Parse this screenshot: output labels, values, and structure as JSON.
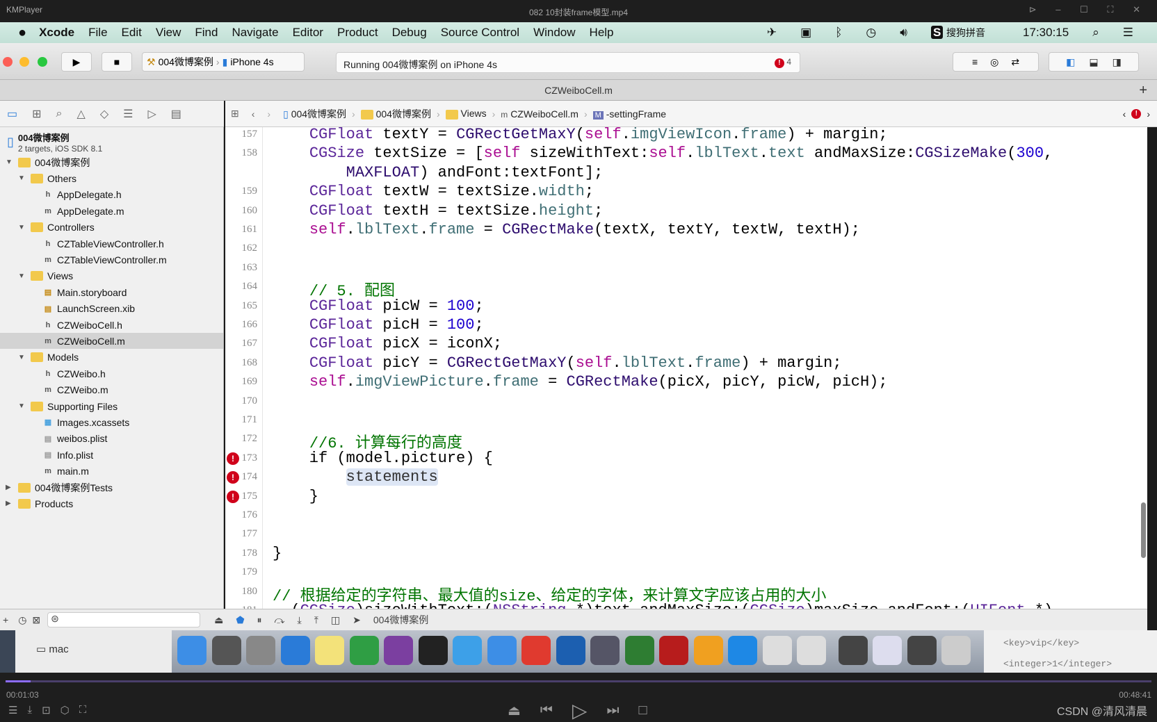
{
  "player": {
    "app": "KMPlayer",
    "title": "082 10封装frame模型.mp4",
    "elapsed": "00:01:03",
    "total": "00:48:41",
    "progress_percent": 2.2,
    "watermark": "CSDN @清风清晨"
  },
  "menubar": {
    "items": [
      "Xcode",
      "File",
      "Edit",
      "View",
      "Find",
      "Navigate",
      "Editor",
      "Product",
      "Debug",
      "Source Control",
      "Window",
      "Help"
    ],
    "input_method": "搜狗拼音",
    "clock": "17:30:15"
  },
  "toolbar": {
    "scheme": "004微博案例",
    "device": "iPhone 4s",
    "status": "Running 004微博案例 on iPhone 4s",
    "error_count": "4"
  },
  "tab": {
    "title": "CZWeiboCell.m"
  },
  "jumpbar": {
    "items": [
      "004微博案例",
      "004微博案例",
      "Views",
      "CZWeiboCell.m",
      "-settingFrame"
    ]
  },
  "project": {
    "name": "004微博案例",
    "subtitle": "2 targets, iOS SDK 8.1"
  },
  "tree": [
    {
      "label": "004微博案例",
      "level": 0,
      "kind": "folder",
      "open": true
    },
    {
      "label": "Others",
      "level": 1,
      "kind": "folder",
      "open": true
    },
    {
      "label": "AppDelegate.h",
      "level": 2,
      "kind": "h"
    },
    {
      "label": "AppDelegate.m",
      "level": 2,
      "kind": "m"
    },
    {
      "label": "Controllers",
      "level": 1,
      "kind": "folder",
      "open": true
    },
    {
      "label": "CZTableViewController.h",
      "level": 2,
      "kind": "h"
    },
    {
      "label": "CZTableViewController.m",
      "level": 2,
      "kind": "m"
    },
    {
      "label": "Views",
      "level": 1,
      "kind": "folder",
      "open": true
    },
    {
      "label": "Main.storyboard",
      "level": 2,
      "kind": "sb"
    },
    {
      "label": "LaunchScreen.xib",
      "level": 2,
      "kind": "xib"
    },
    {
      "label": "CZWeiboCell.h",
      "level": 2,
      "kind": "h"
    },
    {
      "label": "CZWeiboCell.m",
      "level": 2,
      "kind": "m",
      "selected": true
    },
    {
      "label": "Models",
      "level": 1,
      "kind": "folder",
      "open": true
    },
    {
      "label": "CZWeibo.h",
      "level": 2,
      "kind": "h"
    },
    {
      "label": "CZWeibo.m",
      "level": 2,
      "kind": "m"
    },
    {
      "label": "Supporting Files",
      "level": 1,
      "kind": "folder",
      "open": true
    },
    {
      "label": "Images.xcassets",
      "level": 2,
      "kind": "assets"
    },
    {
      "label": "weibos.plist",
      "level": 2,
      "kind": "plist"
    },
    {
      "label": "Info.plist",
      "level": 2,
      "kind": "plist"
    },
    {
      "label": "main.m",
      "level": 2,
      "kind": "m"
    },
    {
      "label": "004微博案例Tests",
      "level": 0,
      "kind": "folder",
      "open": false
    },
    {
      "label": "Products",
      "level": 0,
      "kind": "folder",
      "open": false
    }
  ],
  "code": [
    {
      "n": "157",
      "t": [
        [
          "    "
        ],
        [
          "CGFloat",
          "type"
        ],
        [
          " textY = "
        ],
        [
          "CGRectGetMaxY",
          "fn"
        ],
        [
          "("
        ],
        [
          "self",
          "self"
        ],
        [
          "."
        ],
        [
          "imgViewIcon",
          "prop"
        ],
        [
          "."
        ],
        [
          "frame",
          "prop"
        ],
        [
          ") + margin;"
        ]
      ]
    },
    {
      "n": "158",
      "t": [
        [
          "    "
        ],
        [
          "CGSize",
          "type"
        ],
        [
          " textSize = ["
        ],
        [
          "self",
          "self"
        ],
        [
          " sizeWithText:"
        ],
        [
          "self",
          "self"
        ],
        [
          "."
        ],
        [
          "lblText",
          "prop"
        ],
        [
          "."
        ],
        [
          "text",
          "prop"
        ],
        [
          " andMaxSize:"
        ],
        [
          "CGSizeMake",
          "fn"
        ],
        [
          "("
        ],
        [
          "300",
          "num"
        ],
        [
          ","
        ]
      ]
    },
    {
      "n": "",
      "t": [
        [
          "        "
        ],
        [
          "MAXFLOAT",
          "fn"
        ],
        [
          ") andFont:textFont];"
        ]
      ]
    },
    {
      "n": "159",
      "t": [
        [
          "    "
        ],
        [
          "CGFloat",
          "type"
        ],
        [
          " textW = textSize."
        ],
        [
          "width",
          "prop"
        ],
        [
          ";"
        ]
      ]
    },
    {
      "n": "160",
      "t": [
        [
          "    "
        ],
        [
          "CGFloat",
          "type"
        ],
        [
          " textH = textSize."
        ],
        [
          "height",
          "prop"
        ],
        [
          ";"
        ]
      ]
    },
    {
      "n": "161",
      "t": [
        [
          "    "
        ],
        [
          "self",
          "self"
        ],
        [
          "."
        ],
        [
          "lblText",
          "prop"
        ],
        [
          "."
        ],
        [
          "frame",
          "prop"
        ],
        [
          " = "
        ],
        [
          "CGRectMake",
          "fn"
        ],
        [
          "(textX, textY, textW, textH);"
        ]
      ]
    },
    {
      "n": "162",
      "t": []
    },
    {
      "n": "163",
      "t": []
    },
    {
      "n": "164",
      "t": [
        [
          "    "
        ],
        [
          "// 5. 配图",
          "com"
        ]
      ]
    },
    {
      "n": "165",
      "t": [
        [
          "    "
        ],
        [
          "CGFloat",
          "type"
        ],
        [
          " picW = "
        ],
        [
          "100",
          "num"
        ],
        [
          ";"
        ]
      ]
    },
    {
      "n": "166",
      "t": [
        [
          "    "
        ],
        [
          "CGFloat",
          "type"
        ],
        [
          " picH = "
        ],
        [
          "100",
          "num"
        ],
        [
          ";"
        ]
      ]
    },
    {
      "n": "167",
      "t": [
        [
          "    "
        ],
        [
          "CGFloat",
          "type"
        ],
        [
          " picX = iconX;"
        ]
      ]
    },
    {
      "n": "168",
      "t": [
        [
          "    "
        ],
        [
          "CGFloat",
          "type"
        ],
        [
          " picY = "
        ],
        [
          "CGRectGetMaxY",
          "fn"
        ],
        [
          "("
        ],
        [
          "self",
          "self"
        ],
        [
          "."
        ],
        [
          "lblText",
          "prop"
        ],
        [
          "."
        ],
        [
          "frame",
          "prop"
        ],
        [
          ") + margin;"
        ]
      ]
    },
    {
      "n": "169",
      "t": [
        [
          "    "
        ],
        [
          "self",
          "self"
        ],
        [
          "."
        ],
        [
          "imgViewPicture",
          "prop"
        ],
        [
          "."
        ],
        [
          "frame",
          "prop"
        ],
        [
          " = "
        ],
        [
          "CGRectMake",
          "fn"
        ],
        [
          "(picX, picY, picW, picH);"
        ]
      ]
    },
    {
      "n": "170",
      "t": []
    },
    {
      "n": "171",
      "t": []
    },
    {
      "n": "172",
      "t": [
        [
          "    "
        ],
        [
          "//6. 计算每行的高度",
          "com"
        ]
      ]
    },
    {
      "n": "173",
      "t": [
        [
          "    if (model.picture) {"
        ]
      ],
      "error": true
    },
    {
      "n": "174",
      "t": [
        [
          "        "
        ],
        [
          "statements",
          "ph"
        ]
      ],
      "error": true
    },
    {
      "n": "175",
      "t": [
        [
          "    }"
        ]
      ],
      "error": true
    },
    {
      "n": "176",
      "t": []
    },
    {
      "n": "177",
      "t": []
    },
    {
      "n": "178",
      "t": [
        [
          "}"
        ]
      ]
    },
    {
      "n": "179",
      "t": []
    },
    {
      "n": "180",
      "t": [
        [
          "// 根据给定的字符串、最大值的size、给定的字体，来计算文字应该占用的大小",
          "com"
        ]
      ]
    },
    {
      "n": "181",
      "t": [
        [
          "- ("
        ],
        [
          "CGSize",
          "type"
        ],
        [
          ")sizeWithText:("
        ],
        [
          "NSString",
          "type"
        ],
        [
          " *)text andMaxSize:("
        ],
        [
          "CGSize",
          "type"
        ],
        [
          ")maxSize andFont:("
        ],
        [
          "UIFont",
          "type"
        ],
        [
          " *)"
        ]
      ]
    }
  ],
  "debugbar": {
    "target": "004微博案例"
  },
  "dock": {
    "left_label": "mac",
    "right_text": [
      "<key>vip</key>",
      "<integer>1</integer>"
    ]
  },
  "colors": {
    "error": "#d0021b",
    "comment": "#007400",
    "keyword": "#aa0d91",
    "number": "#1c00cf",
    "progress": "#8c6cff"
  }
}
